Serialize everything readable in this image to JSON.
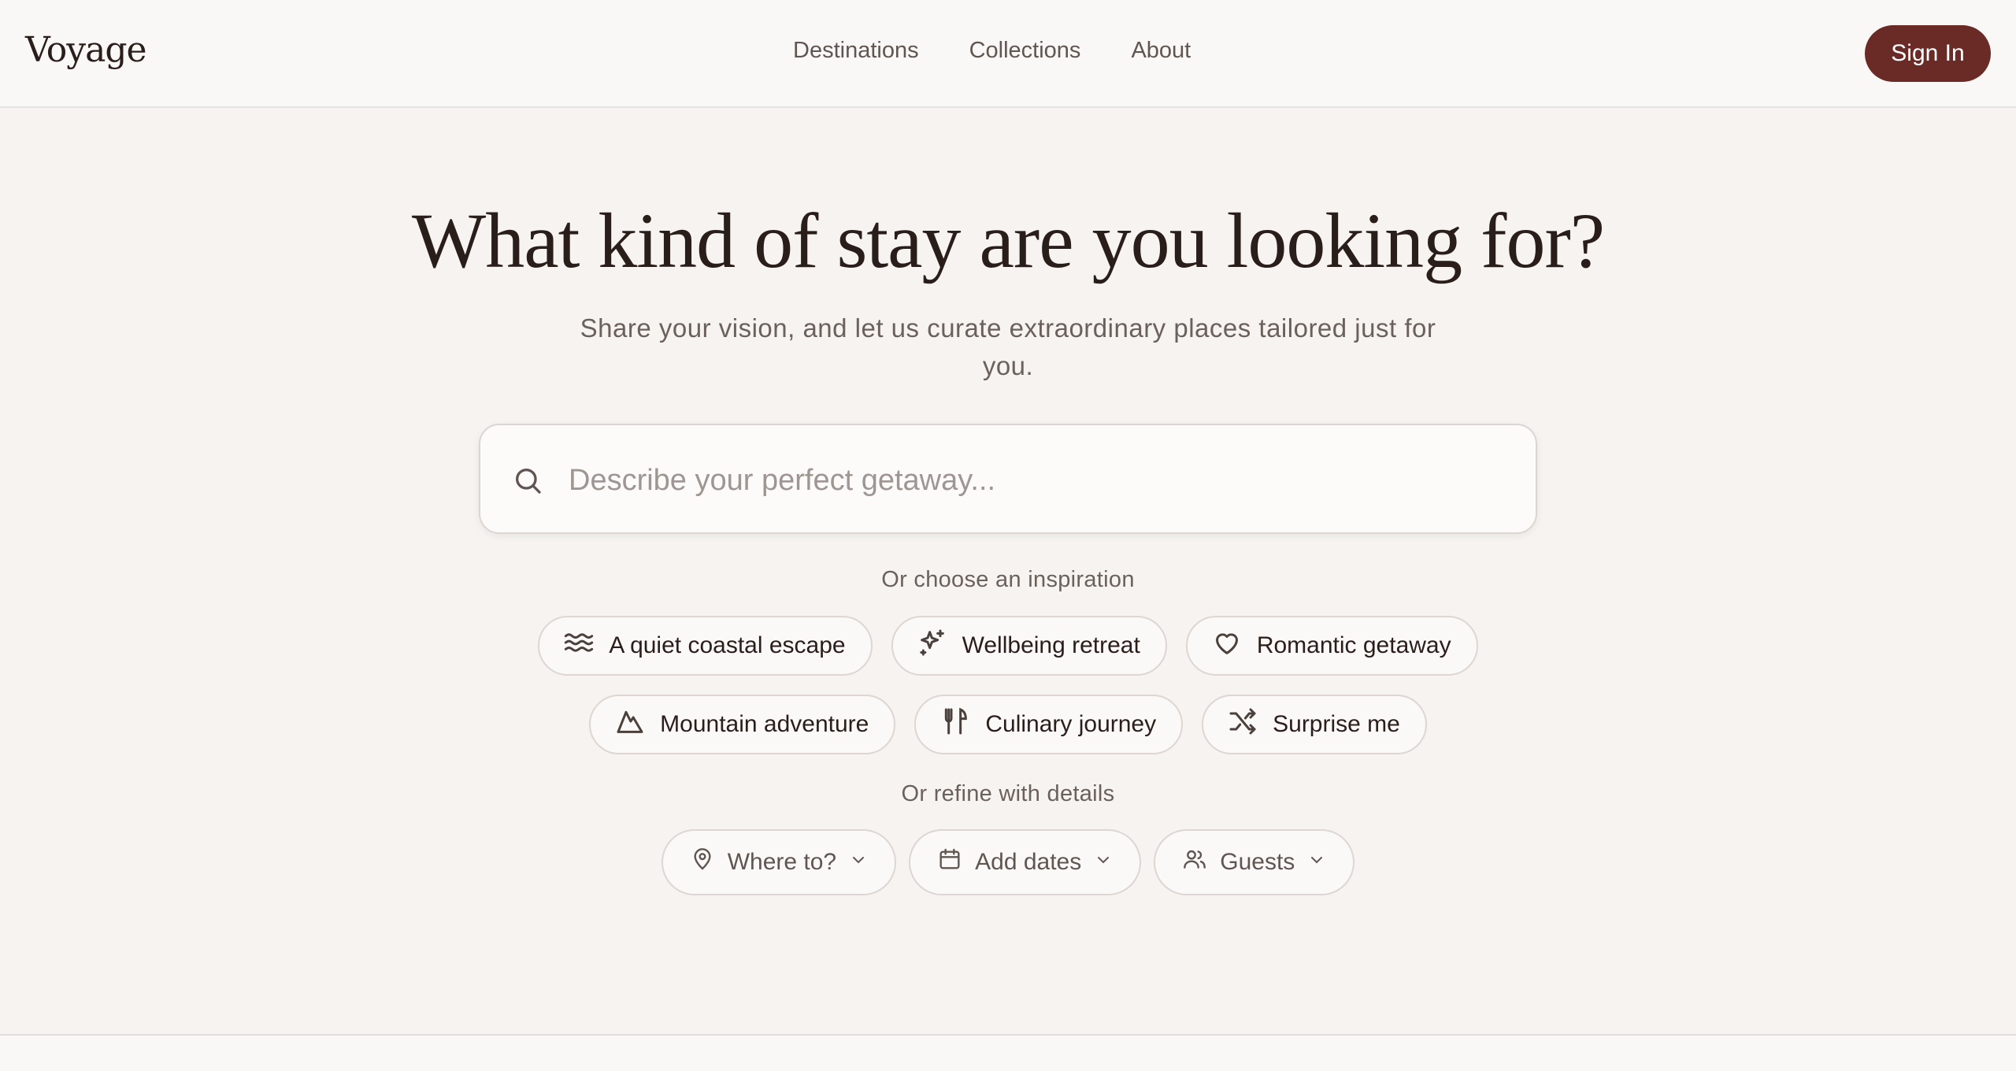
{
  "header": {
    "logo": "Voyage",
    "nav": [
      "Destinations",
      "Collections",
      "About"
    ],
    "sign_in": "Sign In"
  },
  "hero": {
    "title": "What kind of stay are you looking for?",
    "subtitle": "Share your vision, and let us curate extraordinary places tailored just for you."
  },
  "search": {
    "placeholder": "Describe your perfect getaway...",
    "icon": "search-icon"
  },
  "inspiration": {
    "label": "Or choose an inspiration",
    "row1": [
      {
        "label": "A quiet coastal escape",
        "icon": "waves-icon"
      },
      {
        "label": "Wellbeing retreat",
        "icon": "sparkles-icon"
      },
      {
        "label": "Romantic getaway",
        "icon": "heart-icon"
      }
    ],
    "row2": [
      {
        "label": "Mountain adventure",
        "icon": "mountain-icon"
      },
      {
        "label": "Culinary journey",
        "icon": "utensils-icon"
      },
      {
        "label": "Surprise me",
        "icon": "shuffle-icon"
      }
    ]
  },
  "refine": {
    "label": "Or refine with details",
    "filters": [
      {
        "label": "Where to?",
        "icon": "map-pin-icon"
      },
      {
        "label": "Add dates",
        "icon": "calendar-icon"
      },
      {
        "label": "Guests",
        "icon": "users-icon"
      }
    ]
  },
  "colors": {
    "background": "#f6f3f0",
    "header": "#faf8f6",
    "accent": "#6a2a26",
    "text": "#2a1e1b",
    "muted": "#6b615c"
  }
}
